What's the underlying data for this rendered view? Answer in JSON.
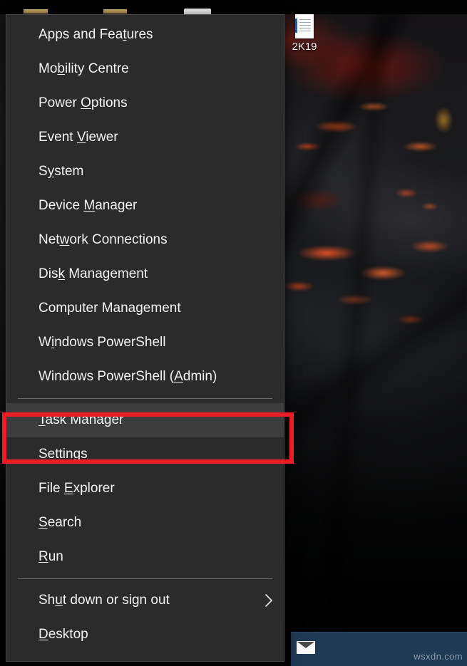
{
  "desktop": {
    "wallpaper_description": "volcanic rock with glowing lava cracks",
    "wallpaper_base_color": "#0a0a0b",
    "lava_color": "#ff5c24",
    "icons": [
      {
        "name": "document-icon",
        "label": "2K19"
      }
    ]
  },
  "taskbar": {
    "background_color": "#1e3a55",
    "items": [
      {
        "name": "mail-icon",
        "label": ""
      }
    ],
    "watermark": "wsxdn.com"
  },
  "menu": {
    "name": "Win+X power user menu",
    "background_color": "#2b2b2b",
    "text_color": "#f2f2f2",
    "highlight_color": "#3d3d3d",
    "groups": [
      {
        "items": [
          {
            "pre": "Apps and Fea",
            "accel": "t",
            "post": "ures",
            "full": "Apps and Features"
          },
          {
            "pre": "Mo",
            "accel": "b",
            "post": "ility Centre",
            "full": "Mobility Centre"
          },
          {
            "pre": "Power ",
            "accel": "O",
            "post": "ptions",
            "full": "Power Options"
          },
          {
            "pre": "Event ",
            "accel": "V",
            "post": "iewer",
            "full": "Event Viewer"
          },
          {
            "pre": "S",
            "accel": "y",
            "post": "stem",
            "full": "System"
          },
          {
            "pre": "Device ",
            "accel": "M",
            "post": "anager",
            "full": "Device Manager"
          },
          {
            "pre": "Net",
            "accel": "w",
            "post": "ork Connections",
            "full": "Network Connections"
          },
          {
            "pre": "Dis",
            "accel": "k",
            "post": " Management",
            "full": "Disk Management"
          },
          {
            "pre": "Computer Management",
            "accel": "",
            "post": "",
            "full": "Computer Management"
          },
          {
            "pre": "W",
            "accel": "i",
            "post": "ndows PowerShell",
            "full": "Windows PowerShell"
          },
          {
            "pre": "Windows PowerShell (",
            "accel": "A",
            "post": "dmin)",
            "full": "Windows PowerShell (Admin)"
          }
        ]
      },
      {
        "items": [
          {
            "pre": "",
            "accel": "T",
            "post": "ask Manager",
            "full": "Task Manager",
            "highlighted": true
          },
          {
            "pre": "Setti",
            "accel": "n",
            "post": "gs",
            "full": "Settings"
          },
          {
            "pre": "File ",
            "accel": "E",
            "post": "xplorer",
            "full": "File Explorer"
          },
          {
            "pre": "",
            "accel": "S",
            "post": "earch",
            "full": "Search"
          },
          {
            "pre": "",
            "accel": "R",
            "post": "un",
            "full": "Run"
          }
        ]
      },
      {
        "items": [
          {
            "pre": "Sh",
            "accel": "u",
            "post": "t down or sign out",
            "full": "Shut down or sign out",
            "submenu": true
          },
          {
            "pre": "",
            "accel": "D",
            "post": "esktop",
            "full": "Desktop"
          }
        ]
      }
    ]
  },
  "annotation": {
    "name": "red-highlight-box",
    "color": "#ee1c25",
    "targets": "Task Manager"
  }
}
